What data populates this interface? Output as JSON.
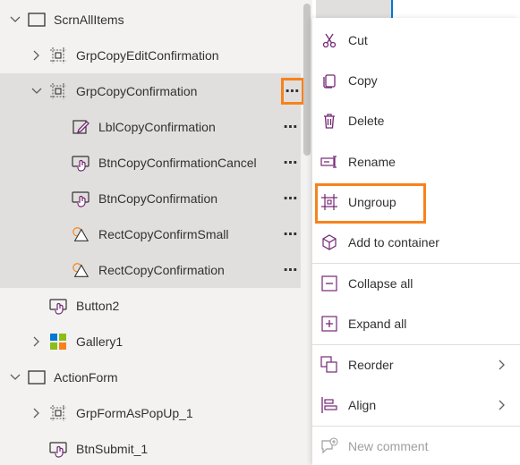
{
  "accent": "#742774",
  "highlight": "#f7821b",
  "tree": {
    "items": [
      {
        "label": "ScrnAllItems",
        "icon": "screen-icon",
        "expander": "expanded"
      },
      {
        "label": "GrpCopyEditConfirmation",
        "icon": "group-icon",
        "expander": "collapsed"
      },
      {
        "label": "GrpCopyConfirmation",
        "icon": "group-icon",
        "expander": "expanded",
        "selected": true,
        "more": "⋯"
      },
      {
        "label": "LblCopyConfirmation",
        "icon": "label-edit-icon",
        "more": "⋯"
      },
      {
        "label": "BtnCopyConfirmationCancel",
        "icon": "button-icon",
        "more": "⋯"
      },
      {
        "label": "BtnCopyConfirmation",
        "icon": "button-icon",
        "more": "⋯"
      },
      {
        "label": "RectCopyConfirmSmall",
        "icon": "shapes-icon",
        "more": "⋯"
      },
      {
        "label": "RectCopyConfirmation",
        "icon": "shapes-icon",
        "more": "⋯"
      },
      {
        "label": "Button2",
        "icon": "button-icon"
      },
      {
        "label": "Gallery1",
        "icon": "gallery-icon",
        "expander": "collapsed"
      },
      {
        "label": "ActionForm",
        "icon": "screen-icon",
        "expander": "expanded"
      },
      {
        "label": "GrpFormAsPopUp_1",
        "icon": "group-icon",
        "expander": "collapsed"
      },
      {
        "label": "BtnSubmit_1",
        "icon": "button-icon"
      }
    ]
  },
  "menu": {
    "items": [
      {
        "label": "Cut",
        "icon": "cut-icon"
      },
      {
        "label": "Copy",
        "icon": "copy-icon"
      },
      {
        "label": "Delete",
        "icon": "delete-icon"
      },
      {
        "label": "Rename",
        "icon": "rename-icon"
      },
      {
        "label": "Ungroup",
        "icon": "ungroup-icon"
      },
      {
        "label": "Add to container",
        "icon": "container-icon"
      },
      {
        "label": "Collapse all",
        "icon": "collapse-all-icon"
      },
      {
        "label": "Expand all",
        "icon": "expand-all-icon"
      },
      {
        "label": "Reorder",
        "icon": "reorder-icon",
        "submenu": true
      },
      {
        "label": "Align",
        "icon": "align-icon",
        "submenu": true
      },
      {
        "label": "New comment",
        "icon": "new-comment-icon",
        "disabled": true
      }
    ]
  }
}
